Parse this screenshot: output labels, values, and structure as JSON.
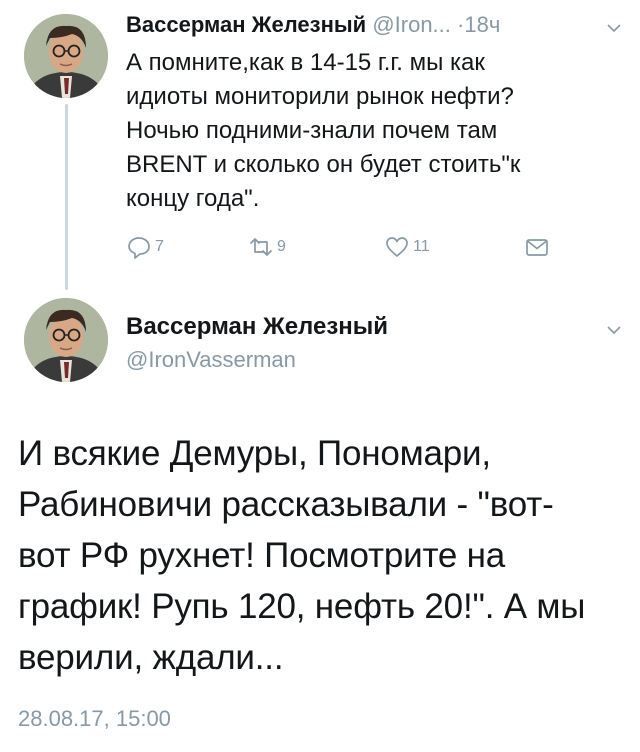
{
  "tweet1": {
    "author_name": "Вассерман Железный",
    "handle": "@Iron...",
    "separator": "·",
    "time": "18ч",
    "text_lines": [
      "А помните,как в 14-15 г.г. мы как",
      "идиоты мониторили рынок нефти?",
      "Ночью подними-знали почем там",
      "BRENT и сколько он будет стоить\"к",
      "концу года\"."
    ],
    "replies": "7",
    "retweets": "9",
    "likes": "11"
  },
  "tweet2": {
    "author_name": "Вассерман Железный",
    "handle": "@IronVasserman",
    "text_lines": [
      "И всякие Демуры, Пономари,",
      "Рабиновичи рассказывали - \"вот-",
      "вот РФ рухнет! Посмотрите на",
      "график! Рупь 120, нефть 20!\". А мы",
      "верили, ждали..."
    ],
    "timestamp": "28.08.17, 15:00"
  },
  "colors": {
    "text": "#14171a",
    "muted": "#8899a6",
    "thread_line": "#ccd6dd"
  },
  "icons": [
    "reply-icon",
    "retweet-icon",
    "like-icon",
    "direct-message-icon",
    "chevron-down-icon"
  ]
}
